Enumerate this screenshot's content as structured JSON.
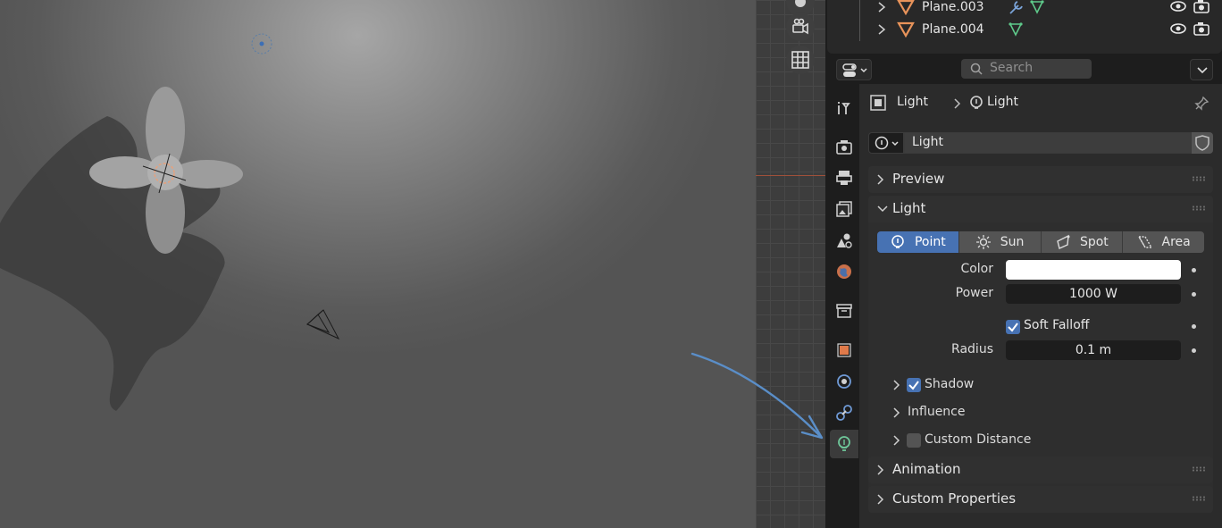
{
  "outliner": {
    "rows": [
      {
        "name": "Plane.003",
        "has_modifier": true
      },
      {
        "name": "Plane.004",
        "has_modifier": false
      }
    ]
  },
  "header": {
    "search_placeholder": "Search"
  },
  "breadcrumb": {
    "object": "Light",
    "data": "Light"
  },
  "datablock": {
    "name": "Light"
  },
  "sections": {
    "preview": "Preview",
    "light": "Light",
    "animation": "Animation",
    "custom_properties": "Custom Properties"
  },
  "light_types": [
    "Point",
    "Sun",
    "Spot",
    "Area"
  ],
  "active_light_type": "Point",
  "properties": {
    "color_label": "Color",
    "color_value": "#ffffff",
    "power_label": "Power",
    "power_value": "1000 W",
    "soft_falloff_label": "Soft Falloff",
    "soft_falloff_checked": true,
    "radius_label": "Radius",
    "radius_value": "0.1 m"
  },
  "subpanels": {
    "shadow": {
      "label": "Shadow",
      "checked": true
    },
    "influence": {
      "label": "Influence"
    },
    "custom_distance": {
      "label": "Custom Distance",
      "checked": false
    }
  },
  "colors": {
    "accent": "#4772b3",
    "light_icon_green": "#6fc79a",
    "annotation_arrow": "#5a8ec8"
  }
}
